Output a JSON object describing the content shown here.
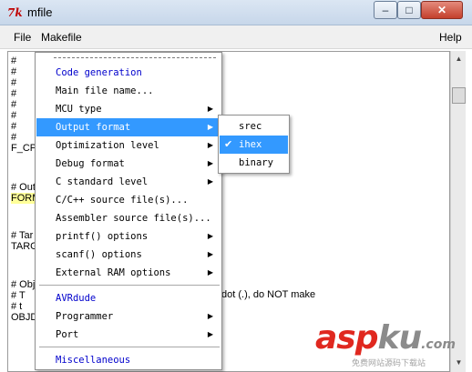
{
  "window": {
    "icon_glyph": "7k",
    "title": "mfile",
    "buttons": {
      "minimize": "–",
      "maximize": "□",
      "close": "✕"
    }
  },
  "menubar": {
    "file": "File",
    "makefile": "Makefile",
    "help": "Help"
  },
  "editor": {
    "lines": [
      "#",
      "#",
      "#",
      "#",
      "#",
      "#",
      "#",
      "#",
      "F_CP",
      "# Out",
      "FORM",
      "# Tar",
      "TARG",
      "# Obj",
      "#   T",
      "#   t",
      "OBJD"
    ],
    "right_text": "dot (.), do NOT make"
  },
  "dropdown": {
    "items": [
      {
        "label": "Code generation",
        "kind": "heading"
      },
      {
        "label": "Main file name...",
        "kind": "item"
      },
      {
        "label": "MCU type",
        "kind": "submenu"
      },
      {
        "label": "Output format",
        "kind": "submenu",
        "active": true
      },
      {
        "label": "Optimization level",
        "kind": "submenu"
      },
      {
        "label": "Debug format",
        "kind": "submenu"
      },
      {
        "label": "C standard level",
        "kind": "submenu"
      },
      {
        "label": "C/C++ source file(s)...",
        "kind": "item"
      },
      {
        "label": "Assembler source file(s)...",
        "kind": "item"
      },
      {
        "label": "printf() options",
        "kind": "submenu"
      },
      {
        "label": "scanf() options",
        "kind": "submenu"
      },
      {
        "label": "External RAM options",
        "kind": "submenu"
      },
      {
        "label": "AVRdude",
        "kind": "heading"
      },
      {
        "label": "Programmer",
        "kind": "submenu"
      },
      {
        "label": "Port",
        "kind": "submenu"
      },
      {
        "label": "Miscellaneous",
        "kind": "heading"
      }
    ]
  },
  "output_format_submenu": {
    "items": [
      {
        "label": "srec",
        "checked": false
      },
      {
        "label": "ihex",
        "checked": true
      },
      {
        "label": "binary",
        "checked": false
      }
    ]
  },
  "watermark": {
    "brand_a": "asp",
    "brand_b": "ku",
    "brand_c": ".com",
    "tagline": "免费网站源码下载站"
  },
  "colors": {
    "menu_highlight": "#3399ff",
    "heading": "#0000cc",
    "highlight_line": "#ffff99",
    "watermark_red": "#e0281f"
  }
}
